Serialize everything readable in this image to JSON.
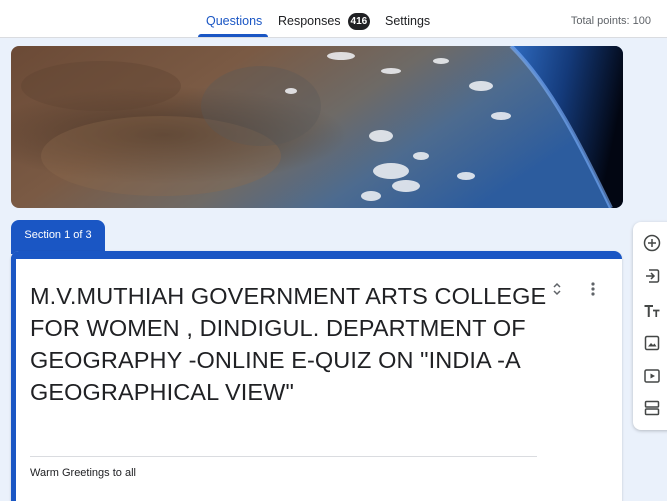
{
  "tabs": {
    "questions": "Questions",
    "responses": "Responses",
    "responses_count": "416",
    "settings": "Settings"
  },
  "total_points": "Total points: 100",
  "section_label": "Section 1 of 3",
  "form": {
    "title": "M.V.MUTHIAH GOVERNMENT ARTS COLLEGE FOR WOMEN , DINDIGUL. DEPARTMENT OF GEOGRAPHY -ONLINE E-QUIZ ON \"INDIA -A GEOGRAPHICAL VIEW\"",
    "description": "Warm Greetings to all"
  },
  "icons": {
    "collapse": "collapse-icon",
    "more": "more-vert-icon",
    "add_question": "add-circle-icon",
    "import_questions": "import-icon",
    "add_title": "title-text-icon",
    "add_image": "image-icon",
    "add_video": "video-icon",
    "add_section": "section-icon"
  },
  "colors": {
    "accent": "#1a56c4",
    "page_background": "#eaf1fb",
    "badge": "#202124"
  }
}
